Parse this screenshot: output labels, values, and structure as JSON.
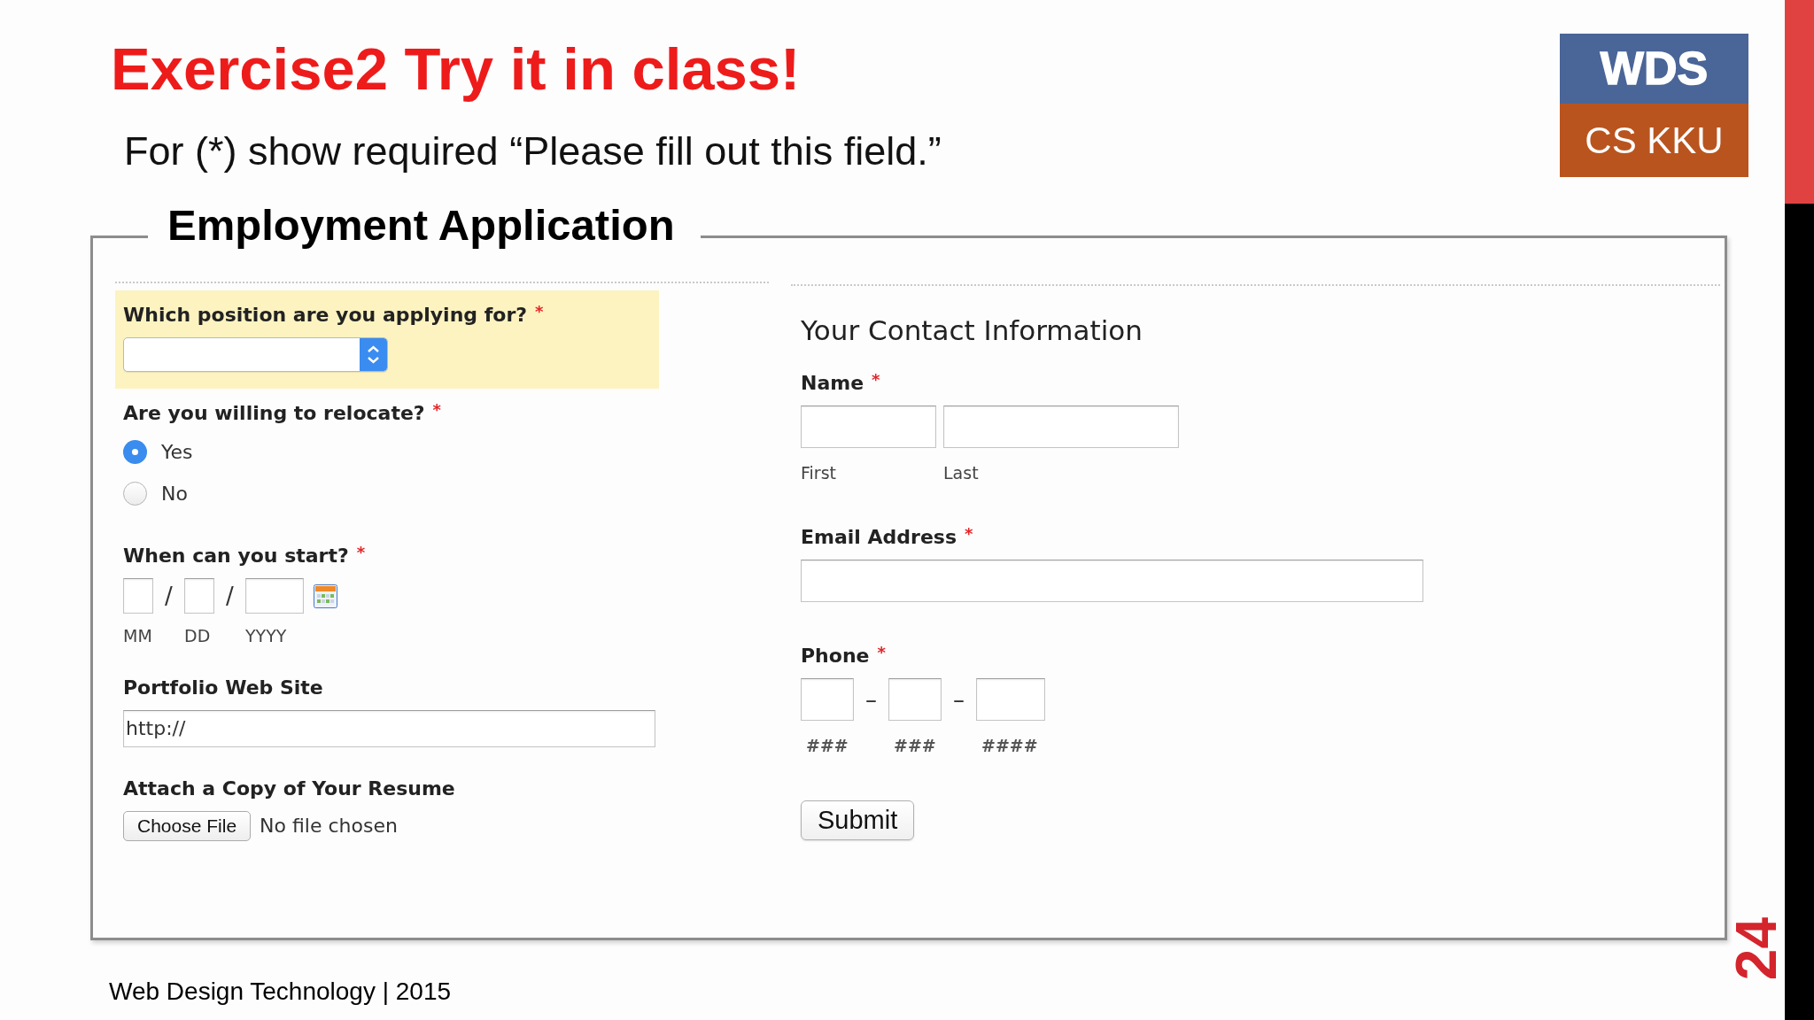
{
  "slide": {
    "title": "Exercise2 Try it in class!",
    "subtitle": "For (*) show required “Please fill out this field.”",
    "logo": {
      "top": "WDS",
      "bottom": "CS KKU"
    }
  },
  "form": {
    "legend": "Employment Application",
    "left_fields": [
      {
        "kind": "select",
        "label": "Which position are you applying for?",
        "required_mark": "*",
        "highlighted": true
      },
      {
        "kind": "radio",
        "label": "Are you willing to relocate?",
        "required_mark": "*",
        "highlighted": false,
        "options": [
          {
            "label": "Yes",
            "selected": true
          },
          {
            "label": "No",
            "selected": false
          }
        ]
      },
      {
        "kind": "date",
        "label": "When can you start?",
        "required_mark": "*",
        "highlighted": false,
        "parts": [
          {
            "sublabel": "MM",
            "separator": "/"
          },
          {
            "sublabel": "DD",
            "separator": "/"
          },
          {
            "sublabel": "YYYY"
          }
        ]
      },
      {
        "kind": "text",
        "label": "Portfolio Web Site",
        "highlighted": false,
        "value": "http://"
      },
      {
        "kind": "file",
        "label": "Attach a Copy of Your Resume",
        "highlighted": false,
        "button": "Choose File",
        "status": "No file chosen"
      }
    ],
    "right_heading": "Your Contact Information",
    "right_fields": [
      {
        "kind": "name",
        "label": "Name",
        "required_mark": "*",
        "highlighted": false,
        "parts": [
          {
            "sublabel": "First"
          },
          {
            "sublabel": "Last"
          }
        ]
      },
      {
        "kind": "text",
        "label": "Email Address",
        "required_mark": "*",
        "highlighted": false
      },
      {
        "kind": "phone",
        "label": "Phone",
        "required_mark": "*",
        "highlighted": false,
        "parts": [
          {
            "sublabel": "###",
            "separator": "–"
          },
          {
            "sublabel": "###",
            "separator": "–"
          },
          {
            "sublabel": "####"
          }
        ]
      }
    ],
    "submit": "Submit"
  },
  "footer": {
    "text": "Web Design Technology | 2015",
    "page_number": "24"
  }
}
